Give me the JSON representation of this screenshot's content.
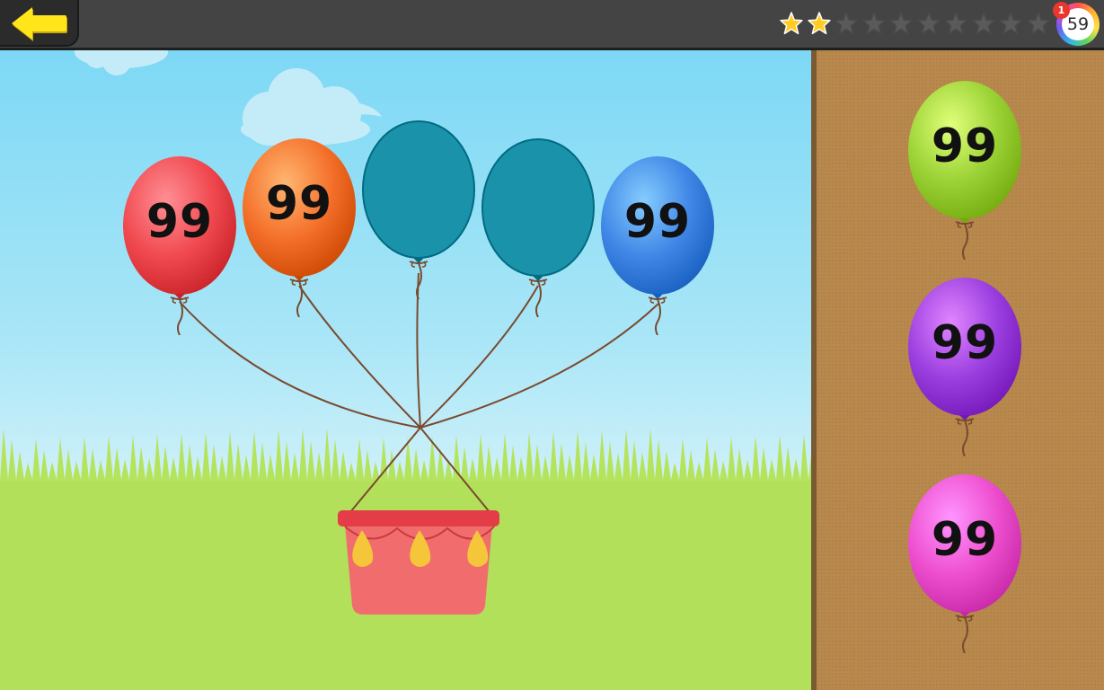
{
  "header": {
    "back_icon": "arrow-left-icon",
    "stars_earned": 2,
    "stars_total": 10,
    "score": "59",
    "notification_count": "1"
  },
  "basket": {
    "balloons": [
      {
        "label": "99",
        "color": "#f0494f",
        "filled": true
      },
      {
        "label": "99",
        "color": "#f4702a",
        "filled": true
      },
      {
        "label": "",
        "color": "#1a93aa",
        "filled": false
      },
      {
        "label": "",
        "color": "#1a93aa",
        "filled": false
      },
      {
        "label": "99",
        "color": "#3f86e6",
        "filled": true
      }
    ],
    "color": "#f06a6a"
  },
  "choices": [
    {
      "label": "99",
      "color": "#9bd235"
    },
    {
      "label": "99",
      "color": "#9b3fe0"
    },
    {
      "label": "99",
      "color": "#ee4fcf"
    }
  ],
  "colors": {
    "gold_star": "#ffcc1f",
    "empty_star": "#5a5a5a",
    "back_arrow": "#ffe51a"
  }
}
